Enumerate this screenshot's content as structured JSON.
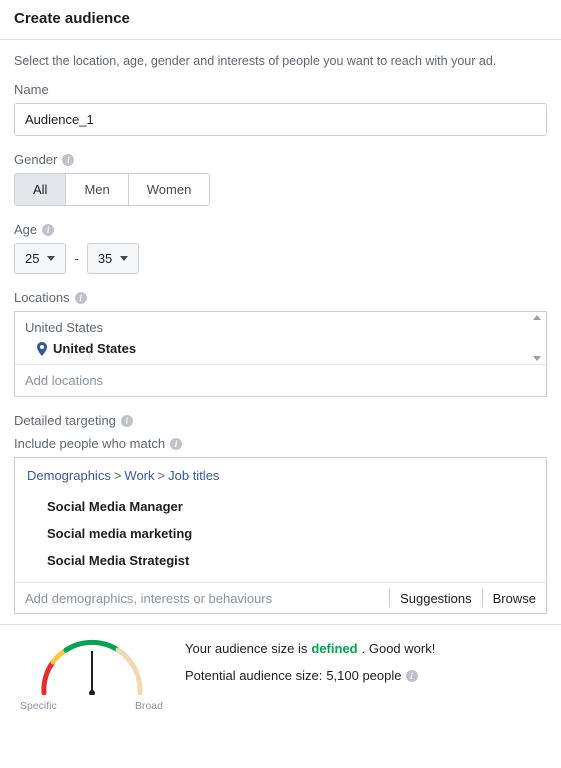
{
  "header": {
    "title": "Create audience"
  },
  "intro": "Select the location, age, gender and interests of people you want to reach with your ad.",
  "name": {
    "label": "Name",
    "value": "Audience_1"
  },
  "gender": {
    "label": "Gender",
    "options": [
      "All",
      "Men",
      "Women"
    ],
    "selected": "All"
  },
  "age": {
    "label": "Age",
    "min": "25",
    "max": "35"
  },
  "locations": {
    "label": "Locations",
    "group": "United States",
    "items": [
      "United States"
    ],
    "add_placeholder": "Add locations"
  },
  "detailed": {
    "label": "Detailed targeting",
    "include_label": "Include people who match",
    "breadcrumb": [
      "Demographics",
      "Work",
      "Job titles"
    ],
    "items": [
      "Social Media Manager",
      "Social media marketing",
      "Social Media Strategist"
    ],
    "add_placeholder": "Add demographics, interests or behaviours",
    "suggestions_label": "Suggestions",
    "browse_label": "Browse"
  },
  "gauge": {
    "specific_label": "Specific",
    "broad_label": "Broad"
  },
  "audience_size": {
    "prefix": "Your audience size is ",
    "status_word": "defined",
    "suffix": ". Good work!",
    "potential_label": "Potential audience size: ",
    "potential_value": "5,100 people"
  }
}
